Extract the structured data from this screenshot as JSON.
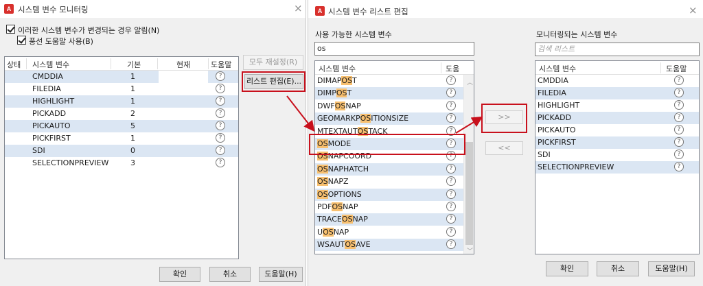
{
  "accent": "#c8101c",
  "monitor": {
    "title": "시스템 변수 모니터링",
    "notify_label": "이러한 시스템 변수가 변경되는 경우 알림(N)",
    "balloon_label": "풍선 도움말 사용(B)",
    "columns": [
      "상태",
      "시스템 변수",
      "기본",
      "현재",
      "도움말"
    ],
    "rows": [
      {
        "name": "CMDDIA",
        "default": "1"
      },
      {
        "name": "FILEDIA",
        "default": "1"
      },
      {
        "name": "HIGHLIGHT",
        "default": "1"
      },
      {
        "name": "PICKADD",
        "default": "2"
      },
      {
        "name": "PICKAUTO",
        "default": "5"
      },
      {
        "name": "PICKFIRST",
        "default": "1"
      },
      {
        "name": "SDI",
        "default": "0"
      },
      {
        "name": "SELECTIONPREVIEW",
        "default": "3"
      }
    ],
    "reset_all_label": "모두 재설정(R)",
    "edit_list_label": "리스트 편집(E)...",
    "ok_label": "확인",
    "cancel_label": "취소",
    "help_label": "도움말(H)"
  },
  "editor": {
    "title": "시스템 변수 리스트 편집",
    "available_label": "사용 가능한 시스템 변수",
    "search_value": "os",
    "monitored_label": "모니터링되는 시스템 변수",
    "search_placeholder": "검색 리스트",
    "columns": [
      "시스템 변수",
      "도움"
    ],
    "right_columns": [
      "시스템 변수",
      "도움말"
    ],
    "available": [
      {
        "pre": "DIMAP",
        "match": "OS",
        "post": "T"
      },
      {
        "pre": "DIMP",
        "match": "OS",
        "post": "T"
      },
      {
        "pre": "DWF",
        "match": "OS",
        "post": "NAP"
      },
      {
        "pre": "GEOMARKP",
        "match": "OS",
        "post": "ITIONSIZE"
      },
      {
        "pre": "MTEXTAUT",
        "match": "OS",
        "post": "TACK"
      },
      {
        "pre": "",
        "match": "OS",
        "post": "MODE"
      },
      {
        "pre": "",
        "match": "OS",
        "post": "NAPCOORD"
      },
      {
        "pre": "",
        "match": "OS",
        "post": "NAPHATCH"
      },
      {
        "pre": "",
        "match": "OS",
        "post": "NAPZ"
      },
      {
        "pre": "",
        "match": "OS",
        "post": "OPTIONS"
      },
      {
        "pre": "PDF",
        "match": "OS",
        "post": "NAP"
      },
      {
        "pre": "TRACE",
        "match": "OS",
        "post": "NAP"
      },
      {
        "pre": "U",
        "match": "OS",
        "post": "NAP"
      },
      {
        "pre": "WSAUT",
        "match": "OS",
        "post": "AVE"
      }
    ],
    "monitored": [
      "CMDDIA",
      "FILEDIA",
      "HIGHLIGHT",
      "PICKADD",
      "PICKAUTO",
      "PICKFIRST",
      "SDI",
      "SELECTIONPREVIEW"
    ],
    "add_label": ">>",
    "remove_label": "<<",
    "ok_label": "확인",
    "cancel_label": "취소",
    "help_label": "도움말(H)"
  }
}
